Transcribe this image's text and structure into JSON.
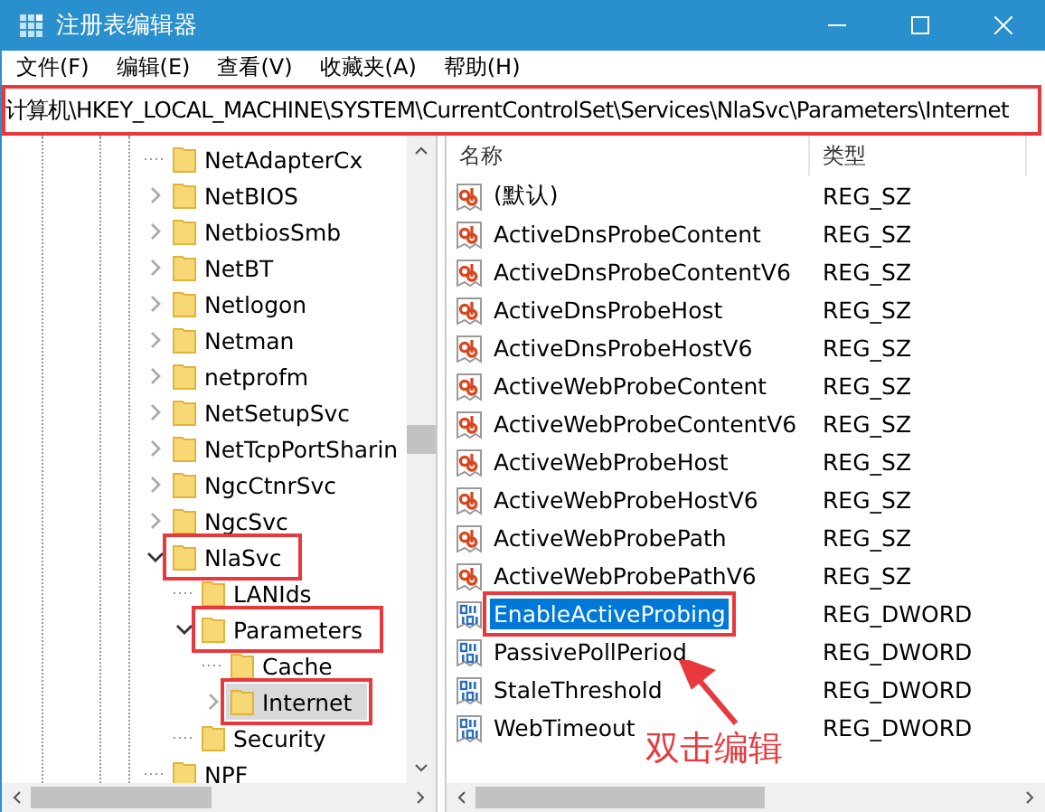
{
  "window": {
    "title": "注册表编辑器"
  },
  "menu": [
    "文件(F)",
    "编辑(E)",
    "查看(V)",
    "收藏夹(A)",
    "帮助(H)"
  ],
  "address": {
    "value": "计算机\\HKEY_LOCAL_MACHINE\\SYSTEM\\CurrentControlSet\\Services\\NlaSvc\\Parameters\\Internet",
    "highlighted": true
  },
  "tree": [
    {
      "label": "NetAdapterCx",
      "has_children": false,
      "expanded": false,
      "selected": false,
      "highlighted": false
    },
    {
      "label": "NetBIOS",
      "has_children": true,
      "expanded": false,
      "selected": false,
      "highlighted": false
    },
    {
      "label": "NetbiosSmb",
      "has_children": true,
      "expanded": false,
      "selected": false,
      "highlighted": false
    },
    {
      "label": "NetBT",
      "has_children": true,
      "expanded": false,
      "selected": false,
      "highlighted": false
    },
    {
      "label": "Netlogon",
      "has_children": true,
      "expanded": false,
      "selected": false,
      "highlighted": false
    },
    {
      "label": "Netman",
      "has_children": true,
      "expanded": false,
      "selected": false,
      "highlighted": false
    },
    {
      "label": "netprofm",
      "has_children": true,
      "expanded": false,
      "selected": false,
      "highlighted": false
    },
    {
      "label": "NetSetupSvc",
      "has_children": true,
      "expanded": false,
      "selected": false,
      "highlighted": false
    },
    {
      "label": "NetTcpPortSharin",
      "has_children": true,
      "expanded": false,
      "selected": false,
      "highlighted": false
    },
    {
      "label": "NgcCtnrSvc",
      "has_children": true,
      "expanded": false,
      "selected": false,
      "highlighted": false
    },
    {
      "label": "NgcSvc",
      "has_children": true,
      "expanded": false,
      "selected": false,
      "highlighted": false
    },
    {
      "label": "NlaSvc",
      "has_children": true,
      "expanded": true,
      "selected": false,
      "highlighted": true,
      "children": [
        {
          "label": "LANIds",
          "has_children": false,
          "expanded": false,
          "selected": false,
          "highlighted": false
        },
        {
          "label": "Parameters",
          "has_children": true,
          "expanded": true,
          "selected": false,
          "highlighted": true,
          "children": [
            {
              "label": "Cache",
              "has_children": false,
              "expanded": false,
              "selected": false,
              "highlighted": false
            },
            {
              "label": "Internet",
              "has_children": true,
              "expanded": false,
              "selected": true,
              "highlighted": true
            }
          ]
        },
        {
          "label": "Security",
          "has_children": false,
          "expanded": false,
          "selected": false,
          "highlighted": false
        }
      ]
    },
    {
      "label": "NPF",
      "has_children": false,
      "expanded": false,
      "selected": false,
      "highlighted": false
    }
  ],
  "columns": [
    "名称",
    "类型"
  ],
  "values": [
    {
      "name": "(默认)",
      "type": "REG_SZ",
      "kind": "string",
      "selected": false,
      "highlighted": false
    },
    {
      "name": "ActiveDnsProbeContent",
      "type": "REG_SZ",
      "kind": "string",
      "selected": false,
      "highlighted": false
    },
    {
      "name": "ActiveDnsProbeContentV6",
      "type": "REG_SZ",
      "kind": "string",
      "selected": false,
      "highlighted": false
    },
    {
      "name": "ActiveDnsProbeHost",
      "type": "REG_SZ",
      "kind": "string",
      "selected": false,
      "highlighted": false
    },
    {
      "name": "ActiveDnsProbeHostV6",
      "type": "REG_SZ",
      "kind": "string",
      "selected": false,
      "highlighted": false
    },
    {
      "name": "ActiveWebProbeContent",
      "type": "REG_SZ",
      "kind": "string",
      "selected": false,
      "highlighted": false
    },
    {
      "name": "ActiveWebProbeContentV6",
      "type": "REG_SZ",
      "kind": "string",
      "selected": false,
      "highlighted": false
    },
    {
      "name": "ActiveWebProbeHost",
      "type": "REG_SZ",
      "kind": "string",
      "selected": false,
      "highlighted": false
    },
    {
      "name": "ActiveWebProbeHostV6",
      "type": "REG_SZ",
      "kind": "string",
      "selected": false,
      "highlighted": false
    },
    {
      "name": "ActiveWebProbePath",
      "type": "REG_SZ",
      "kind": "string",
      "selected": false,
      "highlighted": false
    },
    {
      "name": "ActiveWebProbePathV6",
      "type": "REG_SZ",
      "kind": "string",
      "selected": false,
      "highlighted": false
    },
    {
      "name": "EnableActiveProbing",
      "type": "REG_DWORD",
      "kind": "dword",
      "selected": true,
      "highlighted": true
    },
    {
      "name": "PassivePollPeriod",
      "type": "REG_DWORD",
      "kind": "dword",
      "selected": false,
      "highlighted": false
    },
    {
      "name": "StaleThreshold",
      "type": "REG_DWORD",
      "kind": "dword",
      "selected": false,
      "highlighted": false
    },
    {
      "name": "WebTimeout",
      "type": "REG_DWORD",
      "kind": "dword",
      "selected": false,
      "highlighted": false
    }
  ],
  "annotation": {
    "text": "双击编辑"
  }
}
